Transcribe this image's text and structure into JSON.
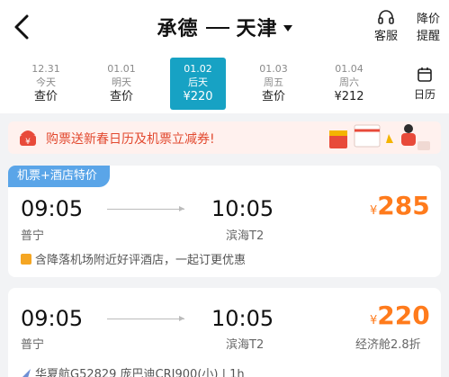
{
  "header": {
    "from": "承德",
    "to": "天津",
    "service_label": "客服",
    "remind_line1": "降价",
    "remind_line2": "提醒"
  },
  "dates": [
    {
      "date": "12.31",
      "weekday": "今天",
      "price": "查价",
      "active": false
    },
    {
      "date": "01.01",
      "weekday": "明天",
      "price": "查价",
      "active": false
    },
    {
      "date": "01.02",
      "weekday": "后天",
      "price": "¥220",
      "active": true
    },
    {
      "date": "01.03",
      "weekday": "周五",
      "price": "查价",
      "active": false
    },
    {
      "date": "01.04",
      "weekday": "周六",
      "price": "¥212",
      "active": false
    }
  ],
  "calendar_label": "日历",
  "banner": {
    "text": "购票送新春日历及机票立减券!"
  },
  "flights": [
    {
      "tag": "机票+酒店特价",
      "depart_time": "09:05",
      "arrive_time": "10:05",
      "depart_airport": "普宁",
      "arrive_airport": "滨海T2",
      "currency": "¥",
      "price": "285",
      "note": "含降落机场附近好评酒店，一起订更优惠"
    },
    {
      "depart_time": "09:05",
      "arrive_time": "10:05",
      "depart_airport": "普宁",
      "arrive_airport": "滨海T2",
      "currency": "¥",
      "price": "220",
      "cabin": "经济舱2.8折",
      "flight_info": "华夏航G52829  庞巴迪CRJ900(小)  |  1h"
    }
  ],
  "colors": {
    "accent": "#17a2c4",
    "price": "#ff7b1c",
    "tag": "#5aa5e8",
    "banner_text": "#e2492f"
  }
}
